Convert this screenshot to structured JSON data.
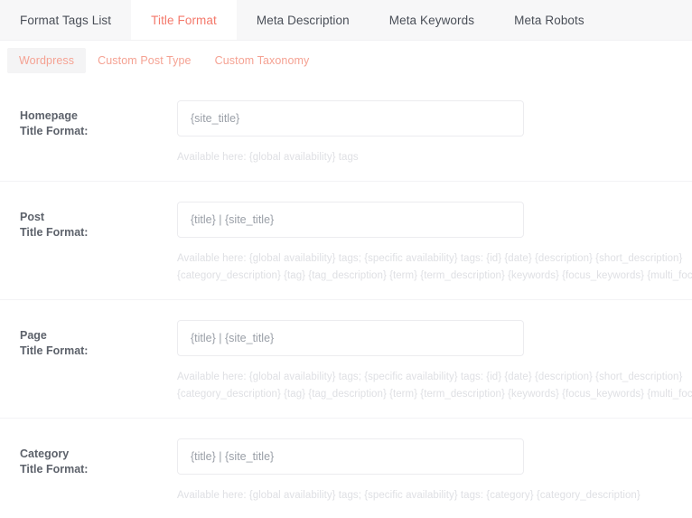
{
  "colors": {
    "accent": "#f4796b",
    "subtab_text": "#f5a293",
    "tabbar_bg": "#f7f7f8",
    "label_text": "#5d626b",
    "input_text": "#9ba0a8",
    "help_text": "#dfe0e4",
    "divider": "#f3f3f5"
  },
  "tabs": [
    {
      "label": "Format Tags List",
      "active": false
    },
    {
      "label": "Title Format",
      "active": true
    },
    {
      "label": "Meta Description",
      "active": false
    },
    {
      "label": "Meta Keywords",
      "active": false
    },
    {
      "label": "Meta Robots",
      "active": false
    }
  ],
  "subtabs": [
    {
      "label": "Wordpress",
      "active": true
    },
    {
      "label": "Custom Post Type",
      "active": false
    },
    {
      "label": "Custom Taxonomy",
      "active": false
    }
  ],
  "rows": [
    {
      "label_line1": "Homepage",
      "label_line2": "Title Format:",
      "value": "{site_title}",
      "help_line1": "Available here: {global availability} tags",
      "help_line2": ""
    },
    {
      "label_line1": "Post",
      "label_line2": "Title Format:",
      "value": "{title} | {site_title}",
      "help_line1": "Available here: {global availability} tags; {specific availability} tags: {id} {date} {description} {short_description}",
      "help_line2": "{category_description} {tag} {tag_description} {term} {term_description} {keywords} {focus_keywords} {multi_focus_keywords}"
    },
    {
      "label_line1": "Page",
      "label_line2": "Title Format:",
      "value": "{title} | {site_title}",
      "help_line1": "Available here: {global availability} tags; {specific availability} tags: {id} {date} {description} {short_description}",
      "help_line2": "{category_description} {tag} {tag_description} {term} {term_description} {keywords} {focus_keywords} {multi_focus_keywords}"
    },
    {
      "label_line1": "Category",
      "label_line2": "Title Format:",
      "value": "{title} | {site_title}",
      "help_line1": "Available here: {global availability} tags; {specific availability} tags: {category} {category_description}",
      "help_line2": ""
    }
  ]
}
